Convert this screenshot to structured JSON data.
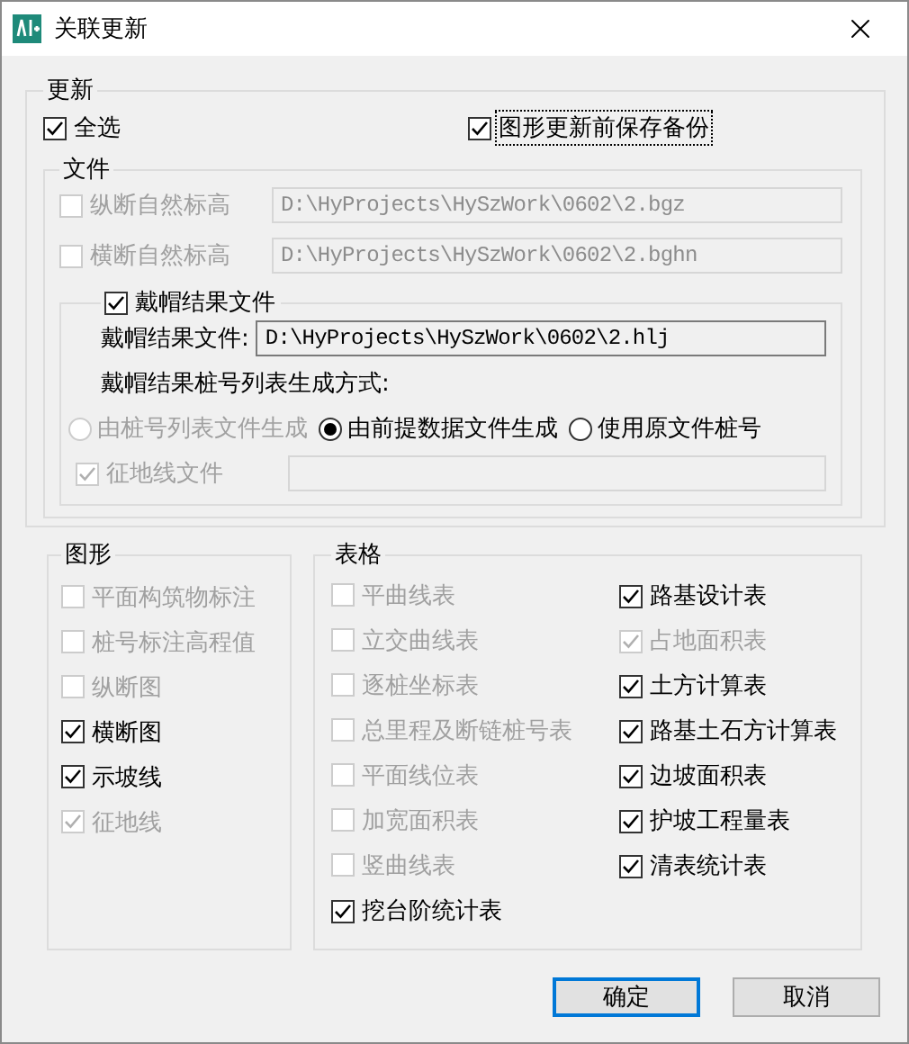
{
  "window": {
    "title": "关联更新"
  },
  "update_group": {
    "title": "更新",
    "select_all": {
      "label": "全选",
      "checked": true,
      "disabled": false,
      "focused": false
    },
    "backup": {
      "label": "图形更新前保存备份",
      "checked": true,
      "disabled": false,
      "focused": true
    },
    "files": {
      "title": "文件",
      "rows": [
        {
          "label": "纵断自然标高",
          "checked": false,
          "disabled": true,
          "value": "D:\\HyProjects\\HySzWork\\0602\\2.bgz"
        },
        {
          "label": "横断自然标高",
          "checked": false,
          "disabled": true,
          "value": "D:\\HyProjects\\HySzWork\\0602\\2.bghn"
        }
      ],
      "cap": {
        "label": "戴帽结果文件",
        "checked": true,
        "disabled": false,
        "file_label": "戴帽结果文件:",
        "file_value": "D:\\HyProjects\\HySzWork\\0602\\2.hlj",
        "method_label": "戴帽结果桩号列表生成方式:",
        "methods": [
          {
            "label": "由桩号列表文件生成",
            "selected": false,
            "disabled": true
          },
          {
            "label": "由前提数据文件生成",
            "selected": true,
            "disabled": false
          },
          {
            "label": "使用原文件桩号",
            "selected": false,
            "disabled": false
          }
        ],
        "land": {
          "label": "征地线文件",
          "checked": true,
          "disabled": true
        }
      }
    }
  },
  "graphics": {
    "title": "图形",
    "items": [
      {
        "label": "平面构筑物标注",
        "checked": false,
        "disabled": true
      },
      {
        "label": "桩号标注高程值",
        "checked": false,
        "disabled": true
      },
      {
        "label": "纵断图",
        "checked": false,
        "disabled": true
      },
      {
        "label": "横断图",
        "checked": true,
        "disabled": false
      },
      {
        "label": "示坡线",
        "checked": true,
        "disabled": false
      },
      {
        "label": "征地线",
        "checked": true,
        "disabled": true
      }
    ]
  },
  "tables": {
    "title": "表格",
    "items": [
      {
        "label": "平曲线表",
        "checked": false,
        "disabled": true
      },
      {
        "label": "立交曲线表",
        "checked": false,
        "disabled": true
      },
      {
        "label": "逐桩坐标表",
        "checked": false,
        "disabled": true
      },
      {
        "label": "总里程及断链桩号表",
        "checked": false,
        "disabled": true
      },
      {
        "label": "平面线位表",
        "checked": false,
        "disabled": true
      },
      {
        "label": "加宽面积表",
        "checked": false,
        "disabled": true
      },
      {
        "label": "竖曲线表",
        "checked": false,
        "disabled": true
      },
      {
        "label": "挖台阶统计表",
        "checked": true,
        "disabled": false
      },
      {
        "label": "路基设计表",
        "checked": true,
        "disabled": false
      },
      {
        "label": "占地面积表",
        "checked": true,
        "disabled": true
      },
      {
        "label": "土方计算表",
        "checked": true,
        "disabled": false
      },
      {
        "label": "路基土石方计算表",
        "checked": true,
        "disabled": false
      },
      {
        "label": "边坡面积表",
        "checked": true,
        "disabled": false
      },
      {
        "label": "护坡工程量表",
        "checked": true,
        "disabled": false
      },
      {
        "label": "清表统计表",
        "checked": true,
        "disabled": false
      }
    ]
  },
  "buttons": [
    {
      "label": "确定",
      "default": true
    },
    {
      "label": "取消",
      "default": false
    }
  ]
}
